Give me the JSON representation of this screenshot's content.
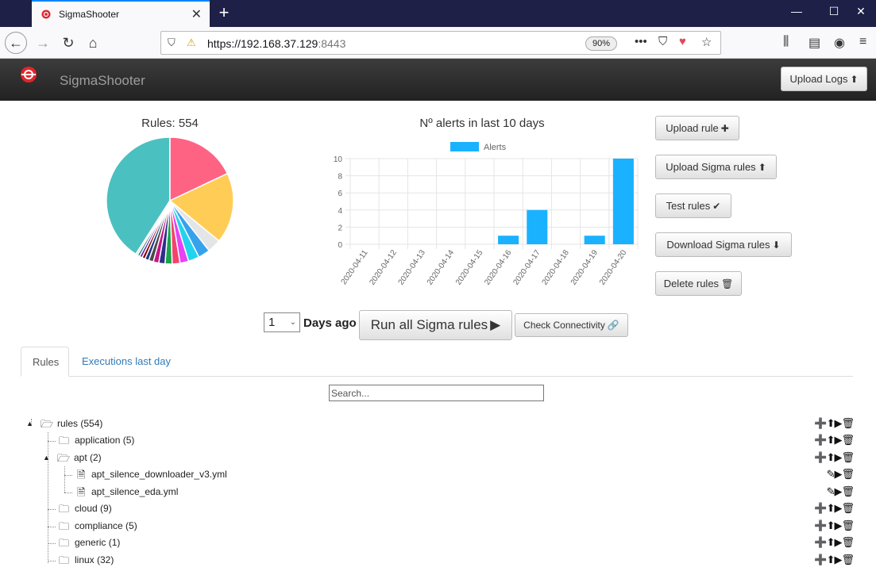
{
  "browser": {
    "tab_title": "SigmaShooter",
    "url_host": "https://192.168.37.129",
    "url_port": ":8443",
    "zoom": "90%"
  },
  "app": {
    "brand": "SigmaShooter",
    "upload_logs": "Upload Logs"
  },
  "pie": {
    "title": "Rules: 554",
    "slices": [
      {
        "value": 0.41,
        "color": "#4bc0c0"
      },
      {
        "value": 0.18,
        "color": "#ff6384"
      },
      {
        "value": 0.18,
        "color": "#ffcd56"
      },
      {
        "value": 0.035,
        "color": "#e4e5e7"
      },
      {
        "value": 0.03,
        "color": "#36a2eb"
      },
      {
        "value": 0.028,
        "color": "#22d3ee"
      },
      {
        "value": 0.022,
        "color": "#e542f5"
      },
      {
        "value": 0.02,
        "color": "#f5426c"
      },
      {
        "value": 0.018,
        "color": "#1aa34a"
      },
      {
        "value": 0.016,
        "color": "#2f2f8f"
      },
      {
        "value": 0.014,
        "color": "#c71585"
      },
      {
        "value": 0.012,
        "color": "#4b4b4b"
      },
      {
        "value": 0.01,
        "color": "#1e3a8a"
      },
      {
        "value": 0.008,
        "color": "#8b0000"
      },
      {
        "value": 0.007,
        "color": "#6b21a8"
      },
      {
        "value": 0.006,
        "color": "#0f766e"
      },
      {
        "value": 0.005,
        "color": "#d1d5db"
      }
    ]
  },
  "chart_data": {
    "type": "bar",
    "title": "Nº alerts in last 10 days",
    "categories": [
      "2020-04-11",
      "2020-04-12",
      "2020-04-13",
      "2020-04-14",
      "2020-04-15",
      "2020-04-16",
      "2020-04-17",
      "2020-04-18",
      "2020-04-19",
      "2020-04-20"
    ],
    "series": [
      {
        "name": "Alerts",
        "values": [
          0,
          0,
          0,
          0,
          0,
          1,
          4,
          0,
          1,
          10
        ],
        "color": "#1ab2ff"
      }
    ],
    "yticks": [
      "10",
      "8",
      "6",
      "4",
      "2",
      "0"
    ],
    "ylim": [
      0,
      10
    ],
    "grid": true,
    "legend": "top"
  },
  "side_buttons": {
    "upload_rule": "Upload rule",
    "upload_sigma": "Upload Sigma rules",
    "test_rules": "Test rules",
    "download_sigma": "Download Sigma rules",
    "delete_rules": "Delete rules"
  },
  "controls": {
    "days_value": "1",
    "days_label": "Days ago",
    "run_all": "Run all Sigma rules",
    "check_conn": "Check Connectivity"
  },
  "tabs": {
    "rules": "Rules",
    "executions": "Executions last day"
  },
  "search": {
    "placeholder": "Search..."
  },
  "tree": {
    "root": "rules (554)",
    "application": "application (5)",
    "apt": "apt (2)",
    "file1": "apt_silence_downloader_v3.yml",
    "file2": "apt_silence_eda.yml",
    "cloud": "cloud (9)",
    "compliance": "compliance (5)",
    "generic": "generic (1)",
    "linux": "linux (32)"
  }
}
